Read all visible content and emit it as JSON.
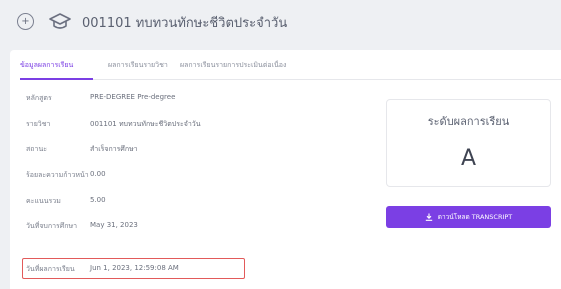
{
  "header": {
    "back_icon": "circle-plus-icon",
    "course_icon": "graduation-cap-icon",
    "title": "001101 ทบทวนทักษะชีวิตประจำวัน"
  },
  "tabs": [
    {
      "label": "ข้อมูลผลการเรียน",
      "active": true
    },
    {
      "label": "ผลการเรียนรายวิชา",
      "active": false
    },
    {
      "label": "ผลการเรียนรายการประเมินต่อเนื่อง",
      "active": false
    }
  ],
  "info": [
    {
      "label": "หลักสูตร",
      "value": "PRE-DEGREE Pre-degree"
    },
    {
      "label": "รายวิชา",
      "value": "001101 ทบทวนทักษะชีวิตประจำวัน"
    },
    {
      "label": "สถานะ",
      "value": "สำเร็จการศึกษา"
    },
    {
      "label": "ร้อยละความก้าวหน้า",
      "value": "0.00"
    },
    {
      "label": "คะแนนรวม",
      "value": "5.00"
    },
    {
      "label": "วันที่จบการศึกษา",
      "value": "May 31, 2023"
    },
    {
      "label": "วันที่ผลการเรียน",
      "value": "Jun 1, 2023, 12:59:08 AM"
    }
  ],
  "grade_box": {
    "title": "ระดับผลการเรียน",
    "grade": "A"
  },
  "transcript_button": {
    "label": "ดาวน์โหลด TRANSCRIPT",
    "icon": "download-icon"
  },
  "colors": {
    "accent": "#7b3fe4",
    "highlight": "#e25a5a"
  }
}
